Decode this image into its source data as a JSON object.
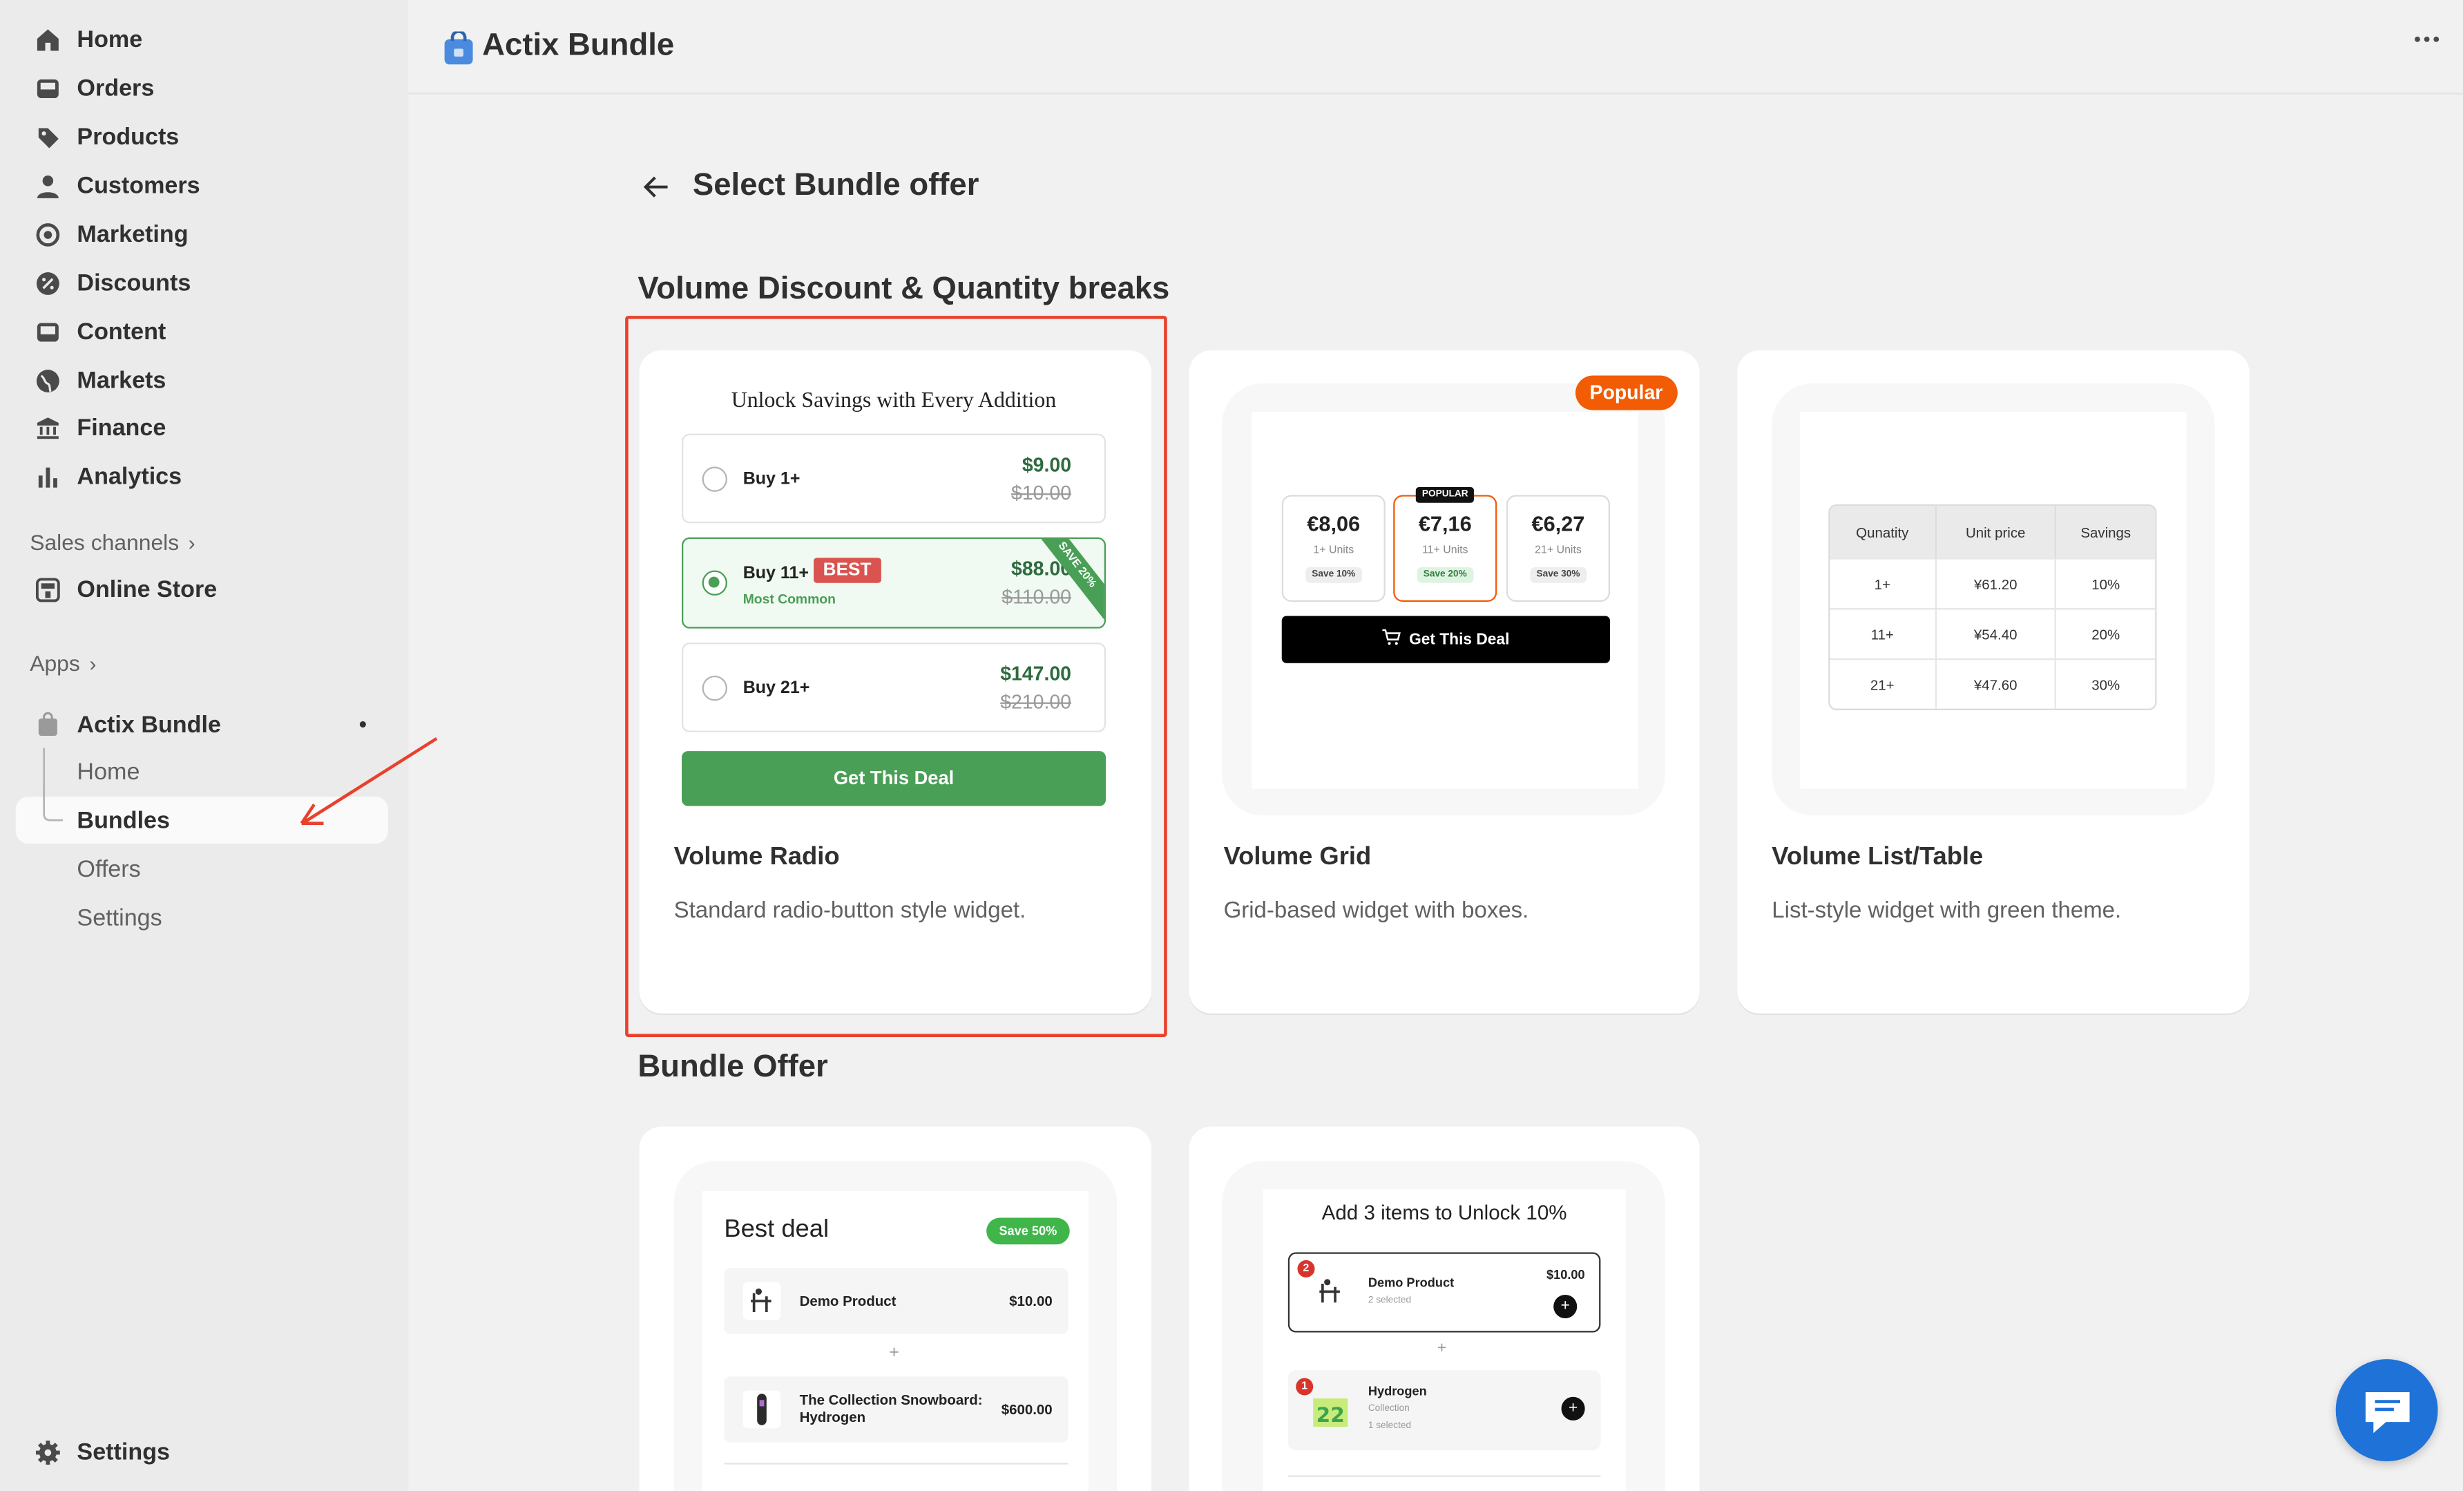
{
  "sidebar": {
    "nav": [
      {
        "label": "Home",
        "icon": "home-icon"
      },
      {
        "label": "Orders",
        "icon": "inbox-icon"
      },
      {
        "label": "Products",
        "icon": "tag-icon"
      },
      {
        "label": "Customers",
        "icon": "person-icon"
      },
      {
        "label": "Marketing",
        "icon": "target-icon"
      },
      {
        "label": "Discounts",
        "icon": "discount-icon"
      },
      {
        "label": "Content",
        "icon": "image-icon"
      },
      {
        "label": "Markets",
        "icon": "globe-icon"
      },
      {
        "label": "Finance",
        "icon": "bank-icon"
      },
      {
        "label": "Analytics",
        "icon": "bar-chart-icon"
      }
    ],
    "sales_channels_label": "Sales channels",
    "online_store_label": "Online Store",
    "apps_label": "Apps",
    "app_name": "Actix Bundle",
    "app_sub": [
      "Home",
      "Bundles",
      "Offers",
      "Settings"
    ],
    "active_sub": "Bundles",
    "settings_label": "Settings"
  },
  "topbar": {
    "app_title": "Actix Bundle",
    "more_label": "..."
  },
  "page": {
    "title": "Select Bundle offer",
    "section_volume": "Volume Discount & Quantity breaks",
    "section_bundle": "Bundle Offer"
  },
  "cards": {
    "radio": {
      "title": "Volume Radio",
      "desc": "Standard radio-button style widget.",
      "heading": "Unlock Savings with Every Addition",
      "options": [
        {
          "label": "Buy 1+",
          "price": "$9.00",
          "old": "$10.00"
        },
        {
          "label": "Buy 11+",
          "badge": "BEST",
          "sub": "Most Common",
          "price": "$88.00",
          "old": "$110.00",
          "ribbon": "SAVE 20%"
        },
        {
          "label": "Buy 21+",
          "price": "$147.00",
          "old": "$210.00"
        }
      ],
      "cta": "Get This Deal"
    },
    "grid": {
      "title": "Volume Grid",
      "desc": "Grid-based widget with boxes.",
      "badge": "Popular",
      "boxes": [
        {
          "price": "€8,06",
          "units": "1+ Units",
          "save": "Save 10%"
        },
        {
          "price": "€7,16",
          "units": "11+ Units",
          "save": "Save 20%",
          "tag": "POPULAR"
        },
        {
          "price": "€6,27",
          "units": "21+ Units",
          "save": "Save 30%"
        }
      ],
      "cta": "Get This Deal"
    },
    "table": {
      "title": "Volume List/Table",
      "desc": "List-style widget with green theme.",
      "headers": [
        "Qunatity",
        "Unit price",
        "Savings"
      ],
      "rows": [
        [
          "1+",
          "¥61.20",
          "10%"
        ],
        [
          "11+",
          "¥54.40",
          "20%"
        ],
        [
          "21+",
          "¥47.60",
          "30%"
        ]
      ]
    },
    "bestdeal": {
      "heading": "Best deal",
      "badge": "Save 50%",
      "items": [
        {
          "name": "Demo Product",
          "price": "$10.00"
        },
        {
          "name": "The Collection Snowboard: Hydrogen",
          "price": "$600.00"
        }
      ],
      "plus": "+"
    },
    "addthree": {
      "heading": "Add 3 items to Unlock 10%",
      "items": [
        {
          "name": "Demo Product",
          "meta": "2 selected",
          "price": "$10.00",
          "count": "2"
        },
        {
          "name": "Hydrogen",
          "meta": "Collection",
          "meta2": "1 selected",
          "count": "1"
        }
      ],
      "plus": "+"
    }
  },
  "colors": {
    "highlight": "#e8412c",
    "green": "#4a9f56",
    "popular": "#f25c05",
    "chat": "#1f72d8"
  }
}
